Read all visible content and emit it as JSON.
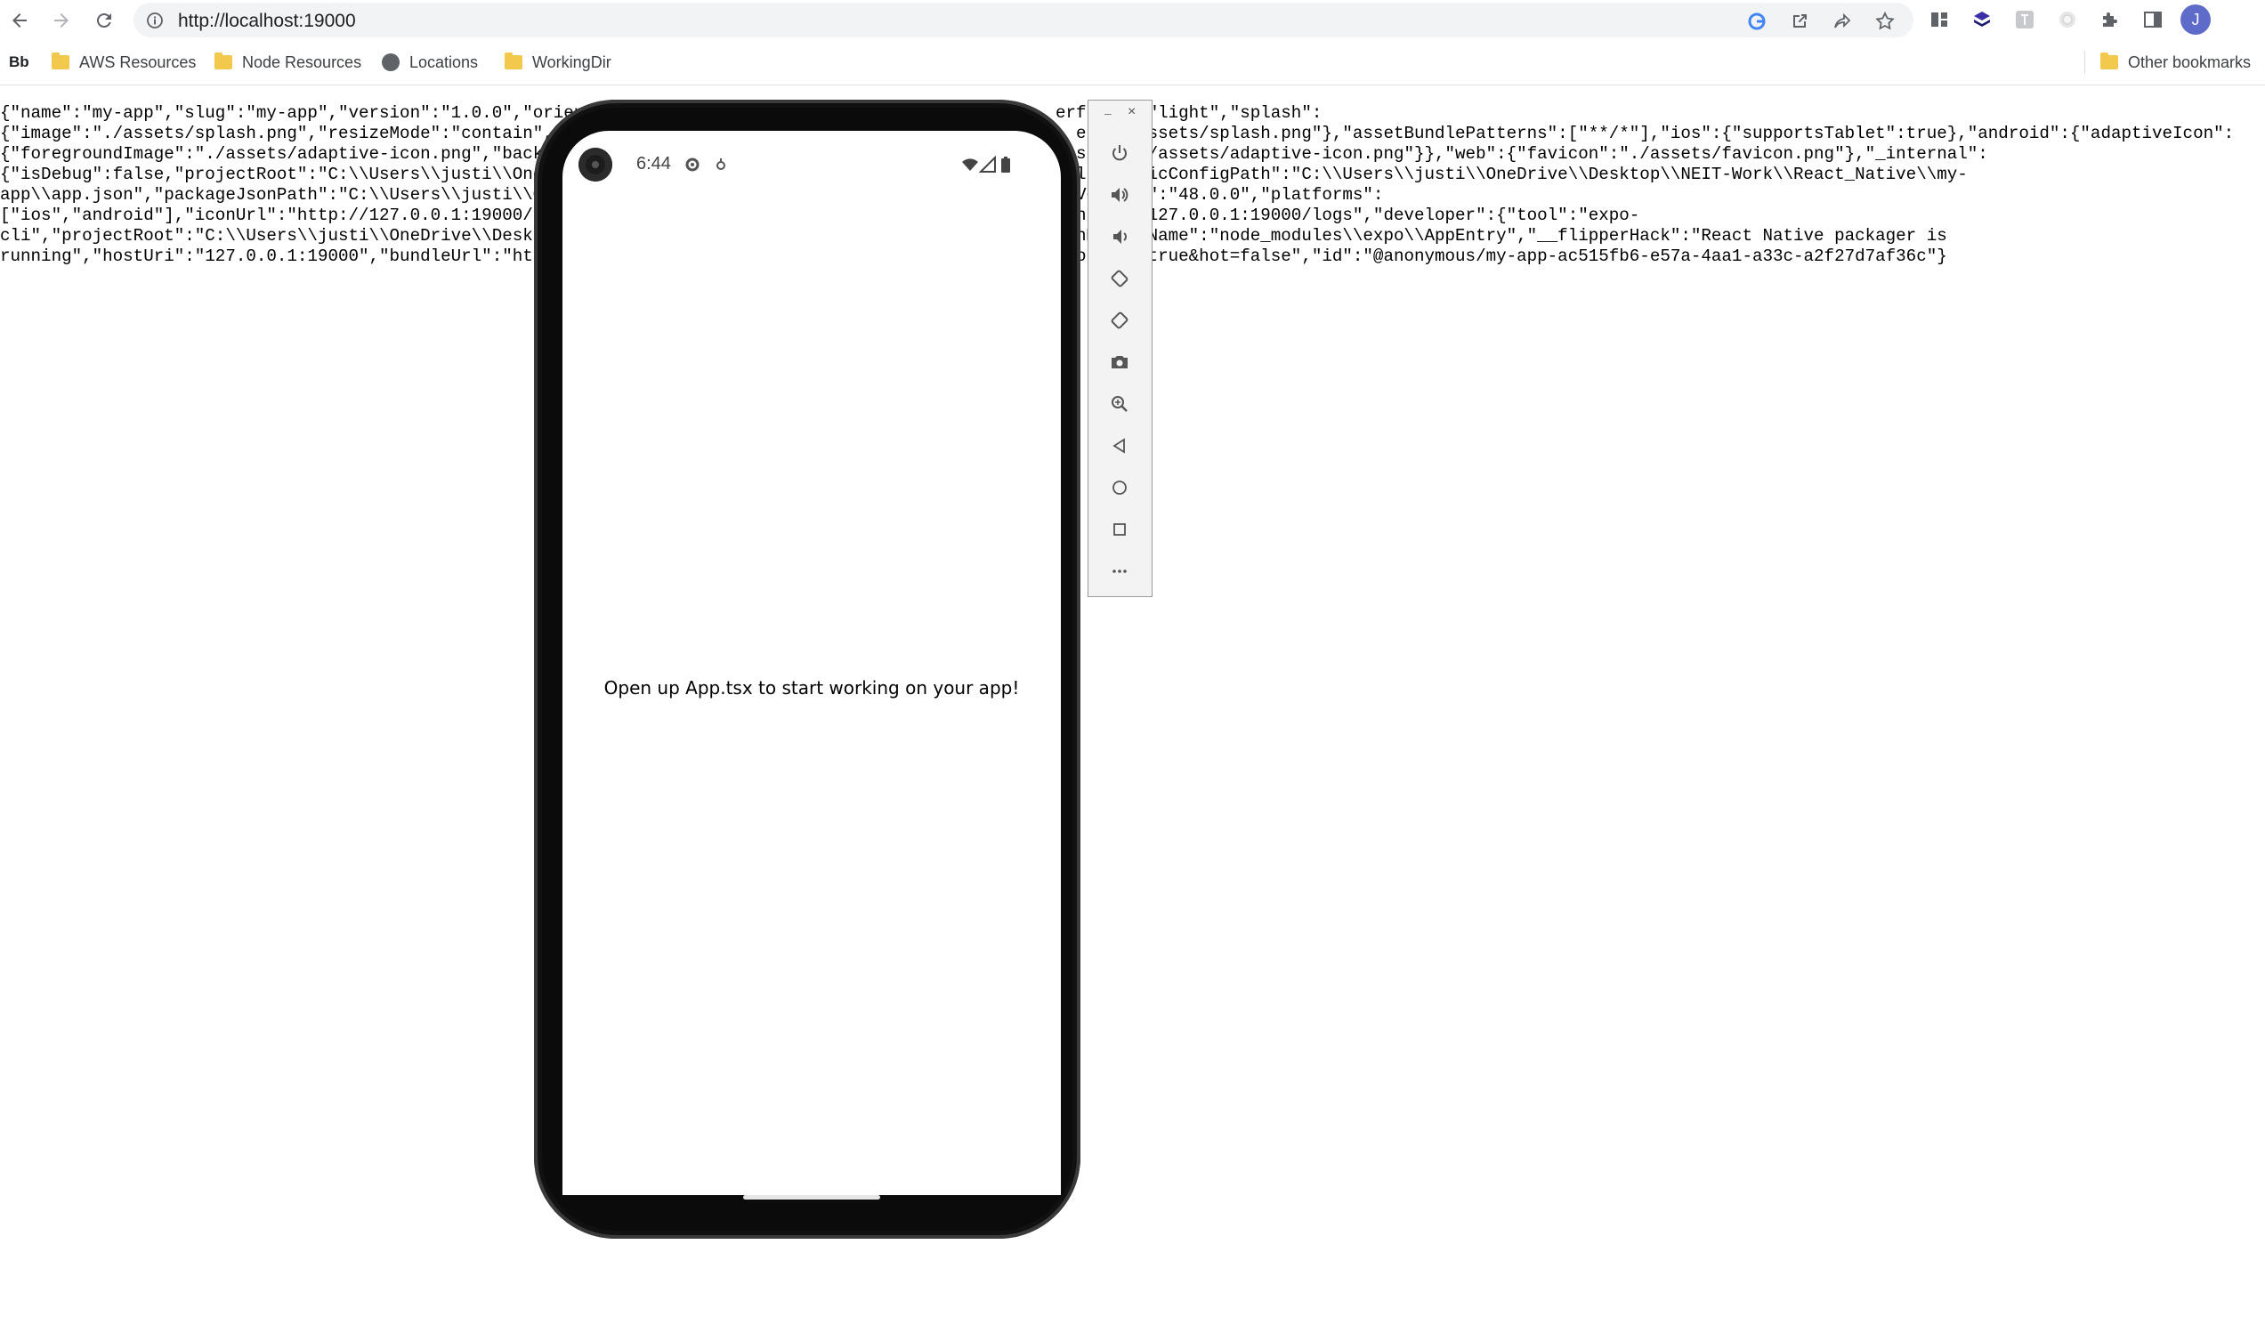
{
  "browser": {
    "url": "http://localhost:19000",
    "avatar_initial": "J",
    "colors": {
      "avatar": "#5f6bc9",
      "folder": "#f2c94c"
    }
  },
  "bookmarks": {
    "items": [
      {
        "label": "Bb",
        "icon": "bb-icon"
      },
      {
        "label": "AWS Resources",
        "icon": "folder-icon"
      },
      {
        "label": "Node Resources",
        "icon": "folder-icon"
      },
      {
        "label": "Locations",
        "icon": "globe-icon"
      },
      {
        "label": "WorkingDir",
        "icon": "folder-icon"
      }
    ],
    "other": "Other bookmarks"
  },
  "page": {
    "json_lines": [
      "{\"name\":\"my-app\",\"slug\":\"my-app\",\"version\":\"1.0.0\",\"orienta                                            erf  le\":\"light\",\"splash\":",
      "{\"image\":\"./assets/splash.png\",\"resizeMode\":\"contain\",\"ba                                            00  ets/./assets/splash.png\"},\"assetBundlePatterns\":[\"**/*\"],\"ios\":{\"supportsTablet\":true},\"android\":{\"adaptiveIcon\":",
      "{\"foregroundImage\":\"./assets/adaptive-icon.png\",\"backgro                                            1  /assets/./assets/adaptive-icon.png\"}},\"web\":{\"favicon\":\"./assets/favicon.png\"},\"_internal\":",
      "{\"isDebug\":false,\"projectRoot\":\"C:\\\\Users\\\\justi\\\\OneDri                                            \":null,\"staticConfigPath\":\"C:\\\\Users\\\\justi\\\\OneDrive\\\\Desktop\\\\NEIT-Work\\\\React_Native\\\\my-",
      "app\\\\app.json\",\"packageJsonPath\":\"C:\\\\Users\\\\justi\\\\OneD                                            s  dkVersion\":\"48.0.0\",\"platforms\":",
      "[\"ios\",\"android\"],\"iconUrl\":\"http://127.0.0.1:19000/asse                                            o   \"http://127.0.0.1:19000/logs\",\"developer\":{\"tool\":\"expo-",
      "cli\",\"projectRoot\":\"C:\\\\Users\\\\justi\\\\OneDrive\\\\Desktop\\                                            \\  ainModuleName\":\"node_modules\\\\expo\\\\AppEntry\",\"__flipperHack\":\"React Native packager is",
      "running\",\"hostUri\":\"127.0.0.1:19000\",\"bundleUrl\":\"http:/                                            a   ios&dev=true&hot=false\",\"id\":\"@anonymous/my-app-ac515fb6-e57a-4aa1-a33c-a2f27d7af36c\"}"
    ]
  },
  "phone": {
    "time": "6:44",
    "app_text": "Open up App.tsx to start working on your app!"
  },
  "emulator_panel": {
    "minimize": "–",
    "close": "×",
    "buttons": [
      "power-icon",
      "volume-up-icon",
      "volume-down-icon",
      "rotate-left-icon",
      "rotate-right-icon",
      "camera-icon",
      "zoom-icon",
      "back-icon",
      "home-icon",
      "overview-icon",
      "more-icon"
    ]
  }
}
